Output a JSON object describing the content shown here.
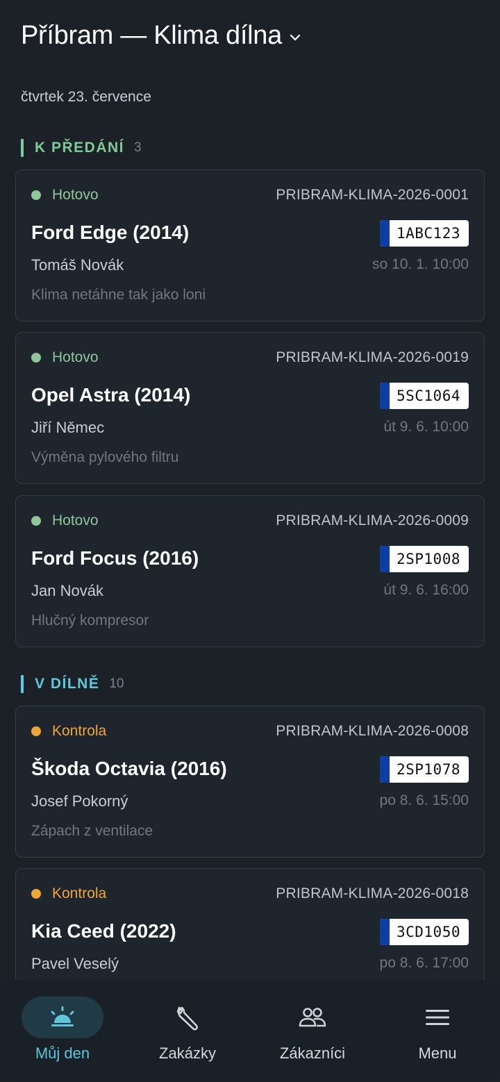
{
  "header": {
    "title": "Příbram — Klima dílna"
  },
  "date": "čtvrtek 23. července",
  "colors": {
    "done": "#8fc79a",
    "check": "#f0a53a",
    "section_done": "#7ecb95",
    "section_shop": "#5ec9df",
    "accent": "#5fc6dc"
  },
  "sections": [
    {
      "label": "K PŘEDÁNÍ",
      "count": "3"
    },
    {
      "label": "V DÍLNĚ",
      "count": "10"
    }
  ],
  "cards": [
    {
      "status": "Hotovo",
      "code": "PRIBRAM-KLIMA-2026-0001",
      "vehicle": "Ford Edge (2014)",
      "plate": "1ABC123",
      "customer": "Tomáš Novák",
      "time": "so 10. 1. 10:00",
      "issue": "Klima netáhne tak jako loni"
    },
    {
      "status": "Hotovo",
      "code": "PRIBRAM-KLIMA-2026-0019",
      "vehicle": "Opel Astra (2014)",
      "plate": "5SC1064",
      "customer": "Jiří Němec",
      "time": "út 9. 6. 10:00",
      "issue": "Výměna pylového filtru"
    },
    {
      "status": "Hotovo",
      "code": "PRIBRAM-KLIMA-2026-0009",
      "vehicle": "Ford Focus (2016)",
      "plate": "2SP1008",
      "customer": "Jan Novák",
      "time": "út 9. 6. 16:00",
      "issue": "Hlučný kompresor"
    },
    {
      "status": "Kontrola",
      "code": "PRIBRAM-KLIMA-2026-0008",
      "vehicle": "Škoda Octavia (2016)",
      "plate": "2SP1078",
      "customer": "Josef Pokorný",
      "time": "po 8. 6. 15:00",
      "issue": "Zápach z ventilace"
    },
    {
      "status": "Kontrola",
      "code": "PRIBRAM-KLIMA-2026-0018",
      "vehicle": "Kia Ceed (2022)",
      "plate": "3CD1050",
      "customer": "Pavel Veselý",
      "time": "po 8. 6. 17:00",
      "issue": ""
    }
  ],
  "tabs": [
    {
      "label": "Můj den",
      "icon": "sunrise-icon"
    },
    {
      "label": "Zakázky",
      "icon": "wrench-icon"
    },
    {
      "label": "Zákazníci",
      "icon": "people-icon"
    },
    {
      "label": "Menu",
      "icon": "hamburger-icon"
    }
  ]
}
